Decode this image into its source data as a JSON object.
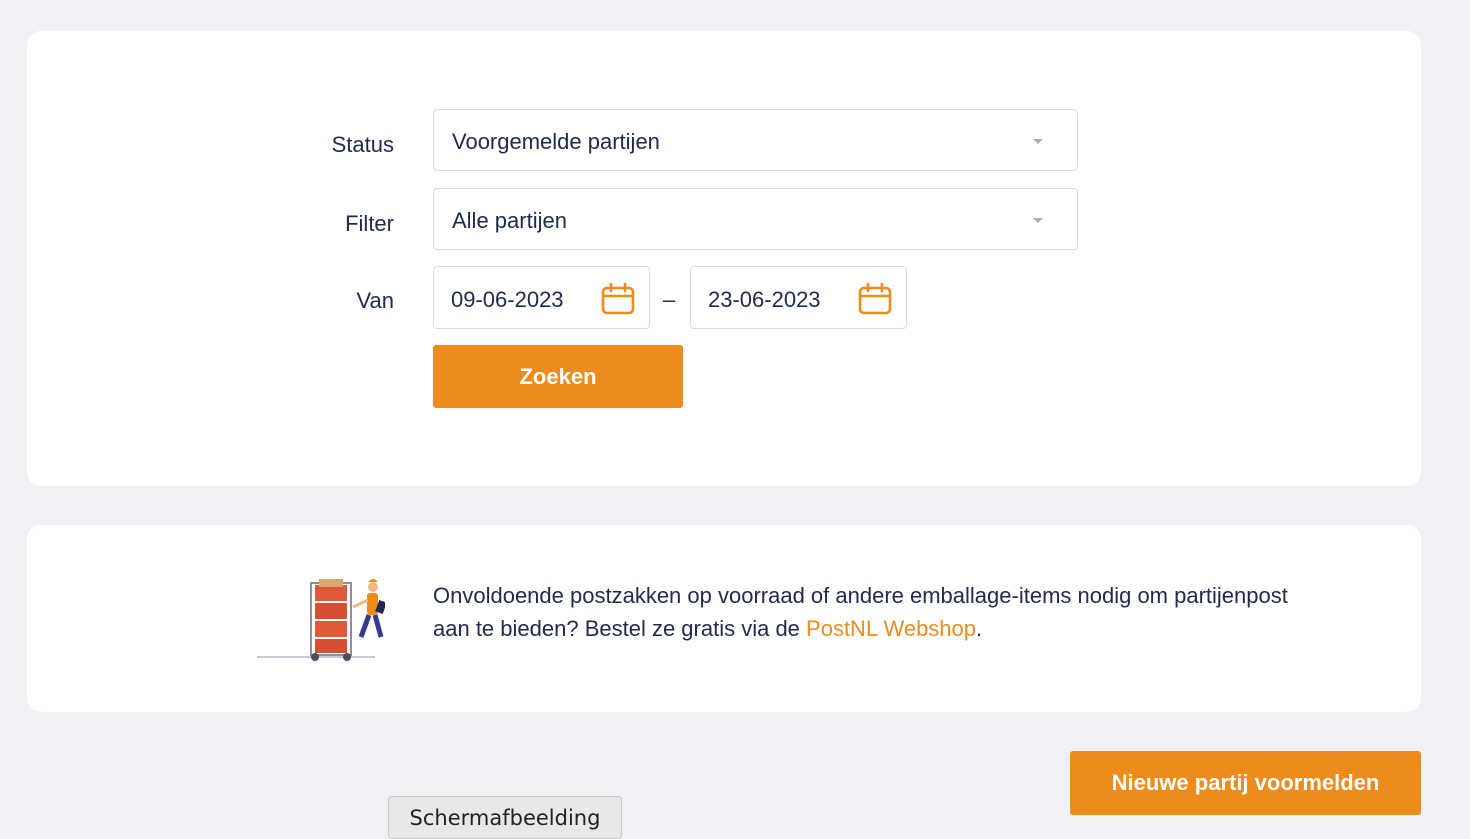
{
  "filters": {
    "status": {
      "label": "Status",
      "value": "Voorgemelde partijen"
    },
    "filter": {
      "label": "Filter",
      "value": "Alle partijen"
    },
    "date_range": {
      "label": "Van",
      "from": "09-06-2023",
      "separator": "–",
      "to": "23-06-2023"
    },
    "search_button": "Zoeken"
  },
  "info": {
    "text_before_link": "Onvoldoende postzakken op voorraad of andere emballage-items nodig om partijenpost aan te bieden? Bestel ze gratis via de ",
    "link_text": "PostNL Webshop",
    "text_after_link": ".",
    "illustration": "courier-with-parcel-trolley-illustration"
  },
  "actions": {
    "new_batch_button": "Nieuwe partij voormelden"
  },
  "tooltip": "Schermafbeelding",
  "colors": {
    "accent": "#ed8c1c",
    "text": "#1f2a4d",
    "background": "#f0f1f5",
    "card": "#ffffff"
  },
  "icons": {
    "calendar": "calendar-icon",
    "dropdown": "chevron-down-icon"
  }
}
